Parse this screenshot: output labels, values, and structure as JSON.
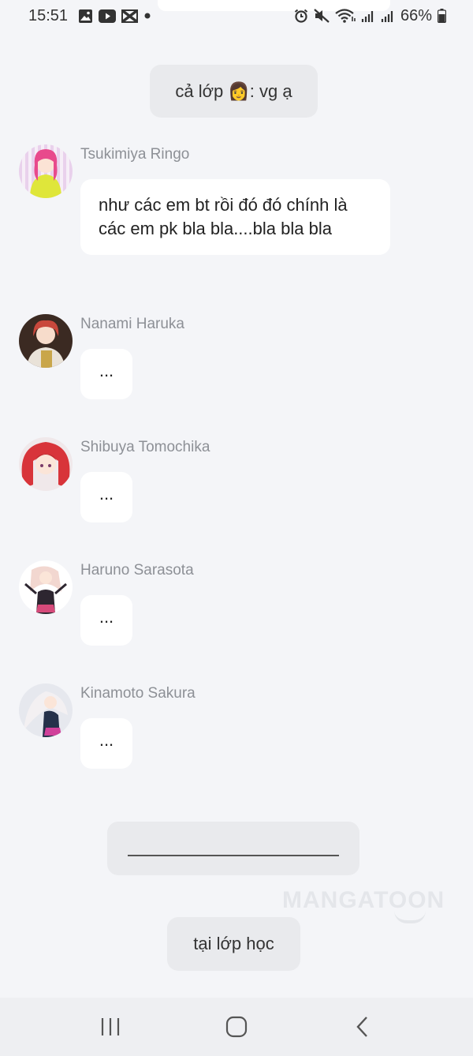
{
  "status_bar": {
    "time": "15:51",
    "battery": "66%",
    "left_icons": [
      "gallery-icon",
      "youtube-icon",
      "capcut-icon",
      "dot-icon"
    ],
    "right_icons": [
      "alarm-icon",
      "mute-icon",
      "wifi-icon",
      "signal-icon",
      "signal-icon",
      "battery-icon"
    ]
  },
  "chat": {
    "system_top": "cả lớp 👩: vg ạ",
    "messages": [
      {
        "sender": "Tsukimiya Ringo",
        "text": "như các em bt rồi đó đó chính là các em pk bla bla....bla bla bla"
      },
      {
        "sender": "Nanami Haruka",
        "text": "..."
      },
      {
        "sender": "Shibuya Tomochika",
        "text": "..."
      },
      {
        "sender": "Haruno Sarasota",
        "text": "..."
      },
      {
        "sender": "Kinamoto Sakura",
        "text": "..."
      }
    ],
    "system_bottom": "tại lớp học"
  },
  "watermark": "MANGATOON",
  "nav_bar": {
    "items": [
      "recent-apps-icon",
      "home-icon",
      "back-icon"
    ]
  }
}
